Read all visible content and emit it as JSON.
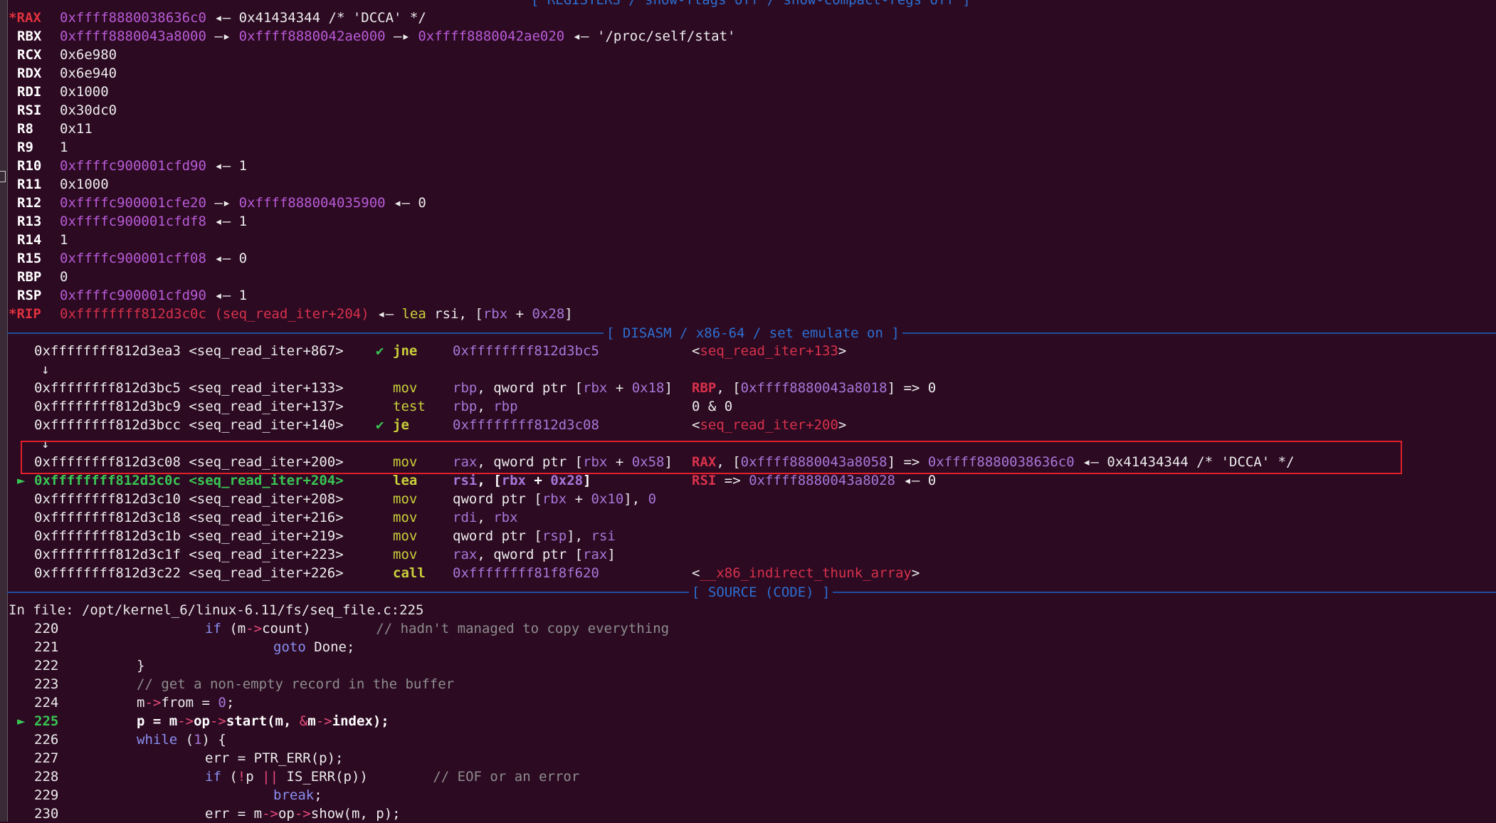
{
  "registers_banner": "[ REGISTERS / show-flags off / show-compact-regs off ]",
  "registers": [
    {
      "name": "*RAX",
      "changed": true,
      "parts": [
        {
          "t": "0xffff8880038636c0",
          "c": "heap"
        },
        {
          "t": " ◂— ",
          "c": "white"
        },
        {
          "t": "0x41434344 /* 'DCCA' */",
          "c": "white"
        }
      ]
    },
    {
      "name": "RBX",
      "changed": false,
      "parts": [
        {
          "t": "0xffff8880043a8000",
          "c": "heap"
        },
        {
          "t": " —▸ ",
          "c": "white"
        },
        {
          "t": "0xffff8880042ae000",
          "c": "heap"
        },
        {
          "t": " —▸ ",
          "c": "white"
        },
        {
          "t": "0xffff8880042ae020",
          "c": "heap"
        },
        {
          "t": " ◂— ",
          "c": "white"
        },
        {
          "t": "'/proc/self/stat'",
          "c": "white"
        }
      ]
    },
    {
      "name": "RCX",
      "changed": false,
      "parts": [
        {
          "t": "0x6e980",
          "c": "white"
        }
      ]
    },
    {
      "name": "RDX",
      "changed": false,
      "parts": [
        {
          "t": "0x6e940",
          "c": "white"
        }
      ]
    },
    {
      "name": "RDI",
      "changed": false,
      "parts": [
        {
          "t": "0x1000",
          "c": "white"
        }
      ]
    },
    {
      "name": "RSI",
      "changed": false,
      "parts": [
        {
          "t": "0x30dc0",
          "c": "white"
        }
      ]
    },
    {
      "name": "R8",
      "changed": false,
      "parts": [
        {
          "t": "0x11",
          "c": "white"
        }
      ]
    },
    {
      "name": "R9",
      "changed": false,
      "parts": [
        {
          "t": "1",
          "c": "white"
        }
      ]
    },
    {
      "name": "R10",
      "changed": false,
      "parts": [
        {
          "t": "0xffffc900001cfd90",
          "c": "heap"
        },
        {
          "t": " ◂— ",
          "c": "white"
        },
        {
          "t": "1",
          "c": "white"
        }
      ]
    },
    {
      "name": "R11",
      "changed": false,
      "parts": [
        {
          "t": "0x1000",
          "c": "white"
        }
      ]
    },
    {
      "name": "R12",
      "changed": false,
      "parts": [
        {
          "t": "0xffffc900001cfe20",
          "c": "heap"
        },
        {
          "t": " —▸ ",
          "c": "white"
        },
        {
          "t": "0xffff888004035900",
          "c": "heap"
        },
        {
          "t": " ◂— ",
          "c": "white"
        },
        {
          "t": "0",
          "c": "white"
        }
      ]
    },
    {
      "name": "R13",
      "changed": false,
      "parts": [
        {
          "t": "0xffffc900001cfdf8",
          "c": "heap"
        },
        {
          "t": " ◂— ",
          "c": "white"
        },
        {
          "t": "1",
          "c": "white"
        }
      ]
    },
    {
      "name": "R14",
      "changed": false,
      "parts": [
        {
          "t": "1",
          "c": "white"
        }
      ]
    },
    {
      "name": "R15",
      "changed": false,
      "parts": [
        {
          "t": "0xffffc900001cff08",
          "c": "heap"
        },
        {
          "t": " ◂— ",
          "c": "white"
        },
        {
          "t": "0",
          "c": "white"
        }
      ]
    },
    {
      "name": "RBP",
      "changed": false,
      "parts": [
        {
          "t": "0",
          "c": "white"
        }
      ]
    },
    {
      "name": "RSP",
      "changed": false,
      "parts": [
        {
          "t": "0xffffc900001cfd90",
          "c": "heap"
        },
        {
          "t": " ◂— ",
          "c": "white"
        },
        {
          "t": "1",
          "c": "white"
        }
      ]
    },
    {
      "name": "*RIP",
      "changed": true,
      "parts": [
        {
          "t": "0xffffffff812d3c0c (seq_read_iter+204)",
          "c": "code"
        },
        {
          "t": " ◂— ",
          "c": "white"
        },
        {
          "t": "lea",
          "c": "mnem-plain"
        },
        {
          "t": " rsi, [",
          "c": "white"
        },
        {
          "t": "rbx",
          "c": "regop"
        },
        {
          "t": " + ",
          "c": "white"
        },
        {
          "t": "0x28",
          "c": "imm"
        },
        {
          "t": "]",
          "c": "white"
        }
      ]
    }
  ],
  "disasm_banner": "[ DISASM / x86-64 / set emulate on ]",
  "disasm": [
    {
      "kind": "ins",
      "addr": "0xffffffff812d3ea3 <seq_read_iter+867>",
      "mark": "✔",
      "mnem": "jne",
      "bold": true,
      "ops": [
        {
          "t": "0xffffffff812d3bc5",
          "c": "addr"
        }
      ],
      "cmt": [
        {
          "t": "<",
          "c": "white"
        },
        {
          "t": "seq_read_iter+133",
          "c": "sym"
        },
        {
          "t": ">",
          "c": "white"
        }
      ]
    },
    {
      "kind": "down",
      "glyph": "↓"
    },
    {
      "kind": "ins",
      "addr": "0xffffffff812d3bc5 <seq_read_iter+133>",
      "mark": "",
      "mnem": "mov",
      "bold": false,
      "ops": [
        {
          "t": "rbp",
          "c": "regop"
        },
        {
          "t": ", qword ptr [",
          "c": "white"
        },
        {
          "t": "rbx",
          "c": "regop"
        },
        {
          "t": " + ",
          "c": "white"
        },
        {
          "t": "0x18",
          "c": "imm"
        },
        {
          "t": "]",
          "c": "white"
        }
      ],
      "cmt": [
        {
          "t": "RBP",
          "c": "sym-bold"
        },
        {
          "t": ", [",
          "c": "white"
        },
        {
          "t": "0xffff8880043a8018",
          "c": "addr"
        },
        {
          "t": "] => 0",
          "c": "white"
        }
      ]
    },
    {
      "kind": "ins",
      "addr": "0xffffffff812d3bc9 <seq_read_iter+137>",
      "mark": "",
      "mnem": "test",
      "bold": false,
      "ops": [
        {
          "t": "rbp",
          "c": "regop"
        },
        {
          "t": ", ",
          "c": "white"
        },
        {
          "t": "rbp",
          "c": "regop"
        }
      ],
      "cmt": [
        {
          "t": "0 & 0",
          "c": "white"
        }
      ]
    },
    {
      "kind": "ins",
      "addr": "0xffffffff812d3bcc <seq_read_iter+140>",
      "mark": "✔",
      "mnem": "je",
      "bold": true,
      "ops": [
        {
          "t": "0xffffffff812d3c08",
          "c": "addr"
        }
      ],
      "cmt": [
        {
          "t": "<",
          "c": "white"
        },
        {
          "t": "seq_read_iter+200",
          "c": "sym"
        },
        {
          "t": ">",
          "c": "white"
        }
      ]
    },
    {
      "kind": "down",
      "glyph": "↓"
    },
    {
      "kind": "ins",
      "addr": "0xffffffff812d3c08 <seq_read_iter+200>",
      "mark": "",
      "mnem": "mov",
      "bold": false,
      "ops": [
        {
          "t": "rax",
          "c": "regop"
        },
        {
          "t": ", qword ptr [",
          "c": "white"
        },
        {
          "t": "rbx",
          "c": "regop"
        },
        {
          "t": " + ",
          "c": "white"
        },
        {
          "t": "0x58",
          "c": "imm"
        },
        {
          "t": "]",
          "c": "white"
        }
      ],
      "cmt": [
        {
          "t": "RAX",
          "c": "sym-bold"
        },
        {
          "t": ", [",
          "c": "white"
        },
        {
          "t": "0xffff8880043a8058",
          "c": "addr"
        },
        {
          "t": "] => ",
          "c": "white"
        },
        {
          "t": "0xffff8880038636c0",
          "c": "addr"
        },
        {
          "t": " ◂— 0x41434344 /* 'DCCA' */",
          "c": "white"
        }
      ]
    },
    {
      "kind": "cur",
      "arrow": "►",
      "addr": "0xffffffff812d3c0c <seq_read_iter+204>",
      "mark": "",
      "mnem": "lea",
      "bold": true,
      "ops": [
        {
          "t": "rsi",
          "c": "regop-bold"
        },
        {
          "t": ", [",
          "c": "bold"
        },
        {
          "t": "rbx",
          "c": "regop-bold"
        },
        {
          "t": " + ",
          "c": "bold"
        },
        {
          "t": "0x28",
          "c": "imm-bold"
        },
        {
          "t": "]",
          "c": "bold"
        }
      ],
      "cmt": [
        {
          "t": "RSI",
          "c": "sym-bold"
        },
        {
          "t": " => ",
          "c": "white"
        },
        {
          "t": "0xffff8880043a8028",
          "c": "addr"
        },
        {
          "t": " ◂— 0",
          "c": "white"
        }
      ]
    },
    {
      "kind": "ins",
      "addr": "0xffffffff812d3c10 <seq_read_iter+208>",
      "mark": "",
      "mnem": "mov",
      "bold": false,
      "ops": [
        {
          "t": "qword ptr [",
          "c": "white"
        },
        {
          "t": "rbx",
          "c": "regop"
        },
        {
          "t": " + ",
          "c": "white"
        },
        {
          "t": "0x10",
          "c": "imm"
        },
        {
          "t": "], ",
          "c": "white"
        },
        {
          "t": "0",
          "c": "imm"
        }
      ],
      "cmt": []
    },
    {
      "kind": "ins",
      "addr": "0xffffffff812d3c18 <seq_read_iter+216>",
      "mark": "",
      "mnem": "mov",
      "bold": false,
      "ops": [
        {
          "t": "rdi",
          "c": "regop"
        },
        {
          "t": ", ",
          "c": "white"
        },
        {
          "t": "rbx",
          "c": "regop"
        }
      ],
      "cmt": []
    },
    {
      "kind": "ins",
      "addr": "0xffffffff812d3c1b <seq_read_iter+219>",
      "mark": "",
      "mnem": "mov",
      "bold": false,
      "ops": [
        {
          "t": "qword ptr [",
          "c": "white"
        },
        {
          "t": "rsp",
          "c": "regop"
        },
        {
          "t": "], ",
          "c": "white"
        },
        {
          "t": "rsi",
          "c": "regop"
        }
      ],
      "cmt": []
    },
    {
      "kind": "ins",
      "addr": "0xffffffff812d3c1f <seq_read_iter+223>",
      "mark": "",
      "mnem": "mov",
      "bold": false,
      "ops": [
        {
          "t": "rax",
          "c": "regop"
        },
        {
          "t": ", qword ptr [",
          "c": "white"
        },
        {
          "t": "rax",
          "c": "regop"
        },
        {
          "t": "]",
          "c": "white"
        }
      ],
      "cmt": []
    },
    {
      "kind": "ins",
      "addr": "0xffffffff812d3c22 <seq_read_iter+226>",
      "mark": "",
      "mnem": "call",
      "bold": true,
      "ops": [
        {
          "t": "0xffffffff81f8f620",
          "c": "addr"
        }
      ],
      "cmt": [
        {
          "t": "<",
          "c": "white"
        },
        {
          "t": "__x86_indirect_thunk_array",
          "c": "sym"
        },
        {
          "t": ">",
          "c": "white"
        }
      ]
    }
  ],
  "source_banner": "[ SOURCE (CODE) ]",
  "source_file": "In file: /opt/kernel_6/linux-6.11/fs/seq_file.c:225",
  "source": [
    {
      "no": "220",
      "cur": false,
      "indent": 2,
      "parts": [
        {
          "t": "if",
          "c": "kw"
        },
        {
          "t": " (m",
          "c": "white"
        },
        {
          "t": "->",
          "c": "op"
        },
        {
          "t": "count)        ",
          "c": "white"
        },
        {
          "t": "// hadn't managed to copy everything",
          "c": "comment"
        }
      ]
    },
    {
      "no": "221",
      "cur": false,
      "indent": 3,
      "parts": [
        {
          "t": "goto",
          "c": "kw"
        },
        {
          "t": " Done;",
          "c": "white"
        }
      ]
    },
    {
      "no": "222",
      "cur": false,
      "indent": 1,
      "parts": [
        {
          "t": "}",
          "c": "white"
        }
      ]
    },
    {
      "no": "223",
      "cur": false,
      "indent": 1,
      "parts": [
        {
          "t": "// get a non-empty record in the buffer",
          "c": "comment"
        }
      ]
    },
    {
      "no": "224",
      "cur": false,
      "indent": 1,
      "parts": [
        {
          "t": "m",
          "c": "white"
        },
        {
          "t": "->",
          "c": "op"
        },
        {
          "t": "from = ",
          "c": "white"
        },
        {
          "t": "0",
          "c": "imm"
        },
        {
          "t": ";",
          "c": "white"
        }
      ]
    },
    {
      "no": "225",
      "cur": true,
      "indent": 1,
      "parts": [
        {
          "t": "p = m",
          "c": "bold"
        },
        {
          "t": "->",
          "c": "op"
        },
        {
          "t": "op",
          "c": "bold"
        },
        {
          "t": "->",
          "c": "op"
        },
        {
          "t": "start(m, ",
          "c": "bold"
        },
        {
          "t": "&",
          "c": "op"
        },
        {
          "t": "m",
          "c": "bold"
        },
        {
          "t": "->",
          "c": "op"
        },
        {
          "t": "index);",
          "c": "bold"
        }
      ]
    },
    {
      "no": "226",
      "cur": false,
      "indent": 1,
      "parts": [
        {
          "t": "while",
          "c": "kw"
        },
        {
          "t": " (",
          "c": "white"
        },
        {
          "t": "1",
          "c": "imm"
        },
        {
          "t": ") {",
          "c": "white"
        }
      ]
    },
    {
      "no": "227",
      "cur": false,
      "indent": 2,
      "parts": [
        {
          "t": "err = PTR_ERR(p);",
          "c": "white"
        }
      ]
    },
    {
      "no": "228",
      "cur": false,
      "indent": 2,
      "parts": [
        {
          "t": "if",
          "c": "kw"
        },
        {
          "t": " (",
          "c": "white"
        },
        {
          "t": "!",
          "c": "op"
        },
        {
          "t": "p ",
          "c": "white"
        },
        {
          "t": "||",
          "c": "op"
        },
        {
          "t": " IS_ERR(p))        ",
          "c": "white"
        },
        {
          "t": "// EOF or an error",
          "c": "comment"
        }
      ]
    },
    {
      "no": "229",
      "cur": false,
      "indent": 3,
      "parts": [
        {
          "t": "break",
          "c": "kw"
        },
        {
          "t": ";",
          "c": "white"
        }
      ]
    },
    {
      "no": "230",
      "cur": false,
      "indent": 2,
      "parts": [
        {
          "t": "err = m",
          "c": "white"
        },
        {
          "t": "->",
          "c": "op"
        },
        {
          "t": "op",
          "c": "white"
        },
        {
          "t": "->",
          "c": "op"
        },
        {
          "t": "show(m, p);",
          "c": "white"
        }
      ]
    }
  ],
  "current_arrow": "►"
}
